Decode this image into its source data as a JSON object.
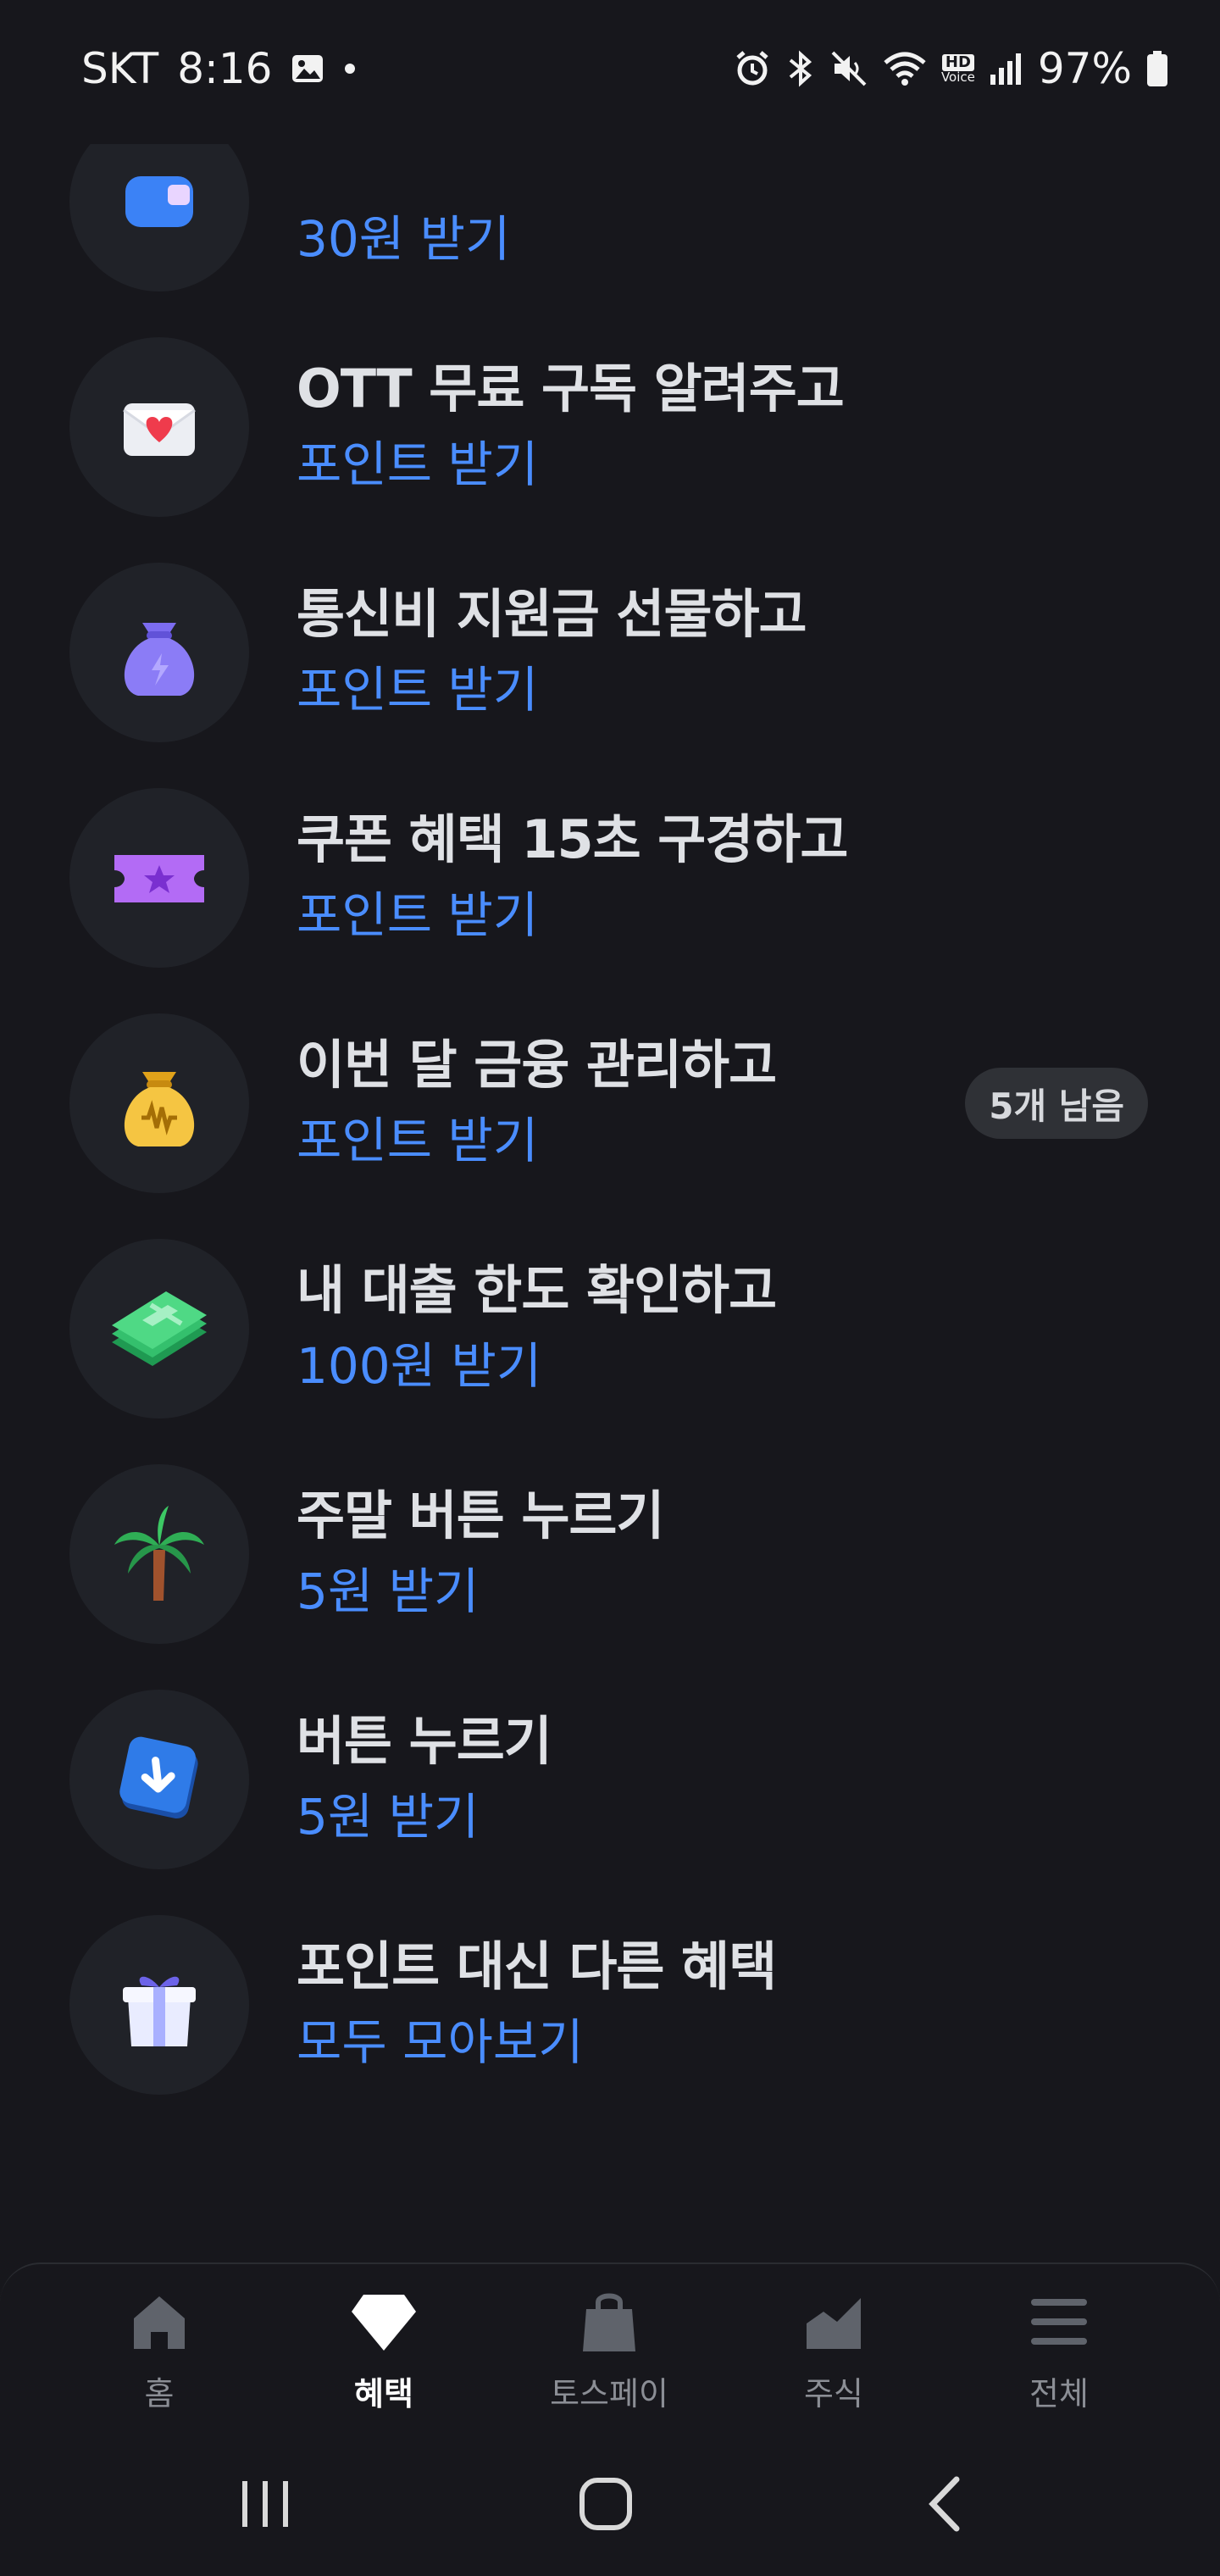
{
  "status_bar": {
    "carrier": "SKT",
    "time": "8:16",
    "battery": "97%",
    "icons": [
      "gallery-icon",
      "dot-icon",
      "alarm-icon",
      "bluetooth-icon",
      "mute-icon",
      "wifi-icon",
      "hd-voice-icon",
      "signal-icon",
      "battery-icon"
    ],
    "hd_label": "HD",
    "voice_label": "Voice"
  },
  "list": {
    "items": [
      {
        "title": "",
        "sub": "30원 받기",
        "icon": "partial-icon"
      },
      {
        "title": "OTT 무료 구독 알려주고",
        "sub": "포인트 받기",
        "icon": "love-letter-icon"
      },
      {
        "title": "통신비 지원금 선물하고",
        "sub": "포인트 받기",
        "icon": "purple-pouch-icon"
      },
      {
        "title": "쿠폰 혜택 15초 구경하고",
        "sub": "포인트 받기",
        "icon": "ticket-icon"
      },
      {
        "title": "이번 달 금융 관리하고",
        "sub": "포인트 받기",
        "icon": "gold-pouch-icon",
        "badge": "5개 남음"
      },
      {
        "title": "내 대출 한도 확인하고",
        "sub": "100원 받기",
        "icon": "money-stack-icon"
      },
      {
        "title": "주말 버튼 누르기",
        "sub": "5원 받기",
        "icon": "palm-tree-icon"
      },
      {
        "title": "버튼 누르기",
        "sub": "5원 받기",
        "icon": "arrow-button-icon"
      },
      {
        "title": "포인트 대신 다른 혜택",
        "sub": "모두 모아보기",
        "icon": "gift-box-icon"
      }
    ]
  },
  "tabbar": {
    "tabs": [
      {
        "label": "홈",
        "icon": "home-icon"
      },
      {
        "label": "혜택",
        "icon": "diamond-icon",
        "active": true
      },
      {
        "label": "토스페이",
        "icon": "shopping-bag-icon"
      },
      {
        "label": "주식",
        "icon": "chart-icon"
      },
      {
        "label": "전체",
        "icon": "menu-icon"
      }
    ]
  },
  "nav": {
    "buttons": [
      "recent-apps-icon",
      "home-button-icon",
      "back-icon"
    ]
  },
  "colors": {
    "background": "#17171c",
    "accent": "#4a8dff",
    "title": "#dfe1e5",
    "circle": "#202228"
  }
}
